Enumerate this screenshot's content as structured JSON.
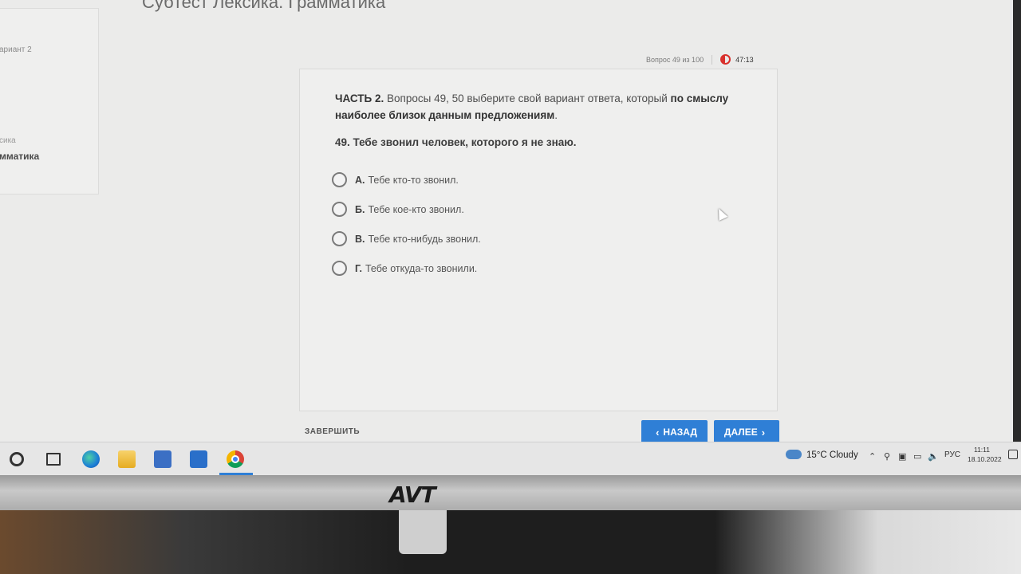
{
  "page": {
    "title": "Субтест Лексика. Грамматика"
  },
  "sidebar": {
    "variant": "ариант 2",
    "small_label": "сика",
    "bold_label": "мматика"
  },
  "meta": {
    "question_counter": "Вопрос 49 из 100",
    "timer": "47:13"
  },
  "card": {
    "instruction_prefix": "ЧАСТЬ 2.",
    "instruction_text": " Вопросы 49, 50 выберите свой вариант ответа, который ",
    "instruction_bold": "по смыслу наиболее близок данным предложениям",
    "instruction_end": ".",
    "question": "49. Тебе звонил человек, которого я не знаю.",
    "options": [
      {
        "letter": "А.",
        "text": "Тебе кто-то звонил."
      },
      {
        "letter": "Б.",
        "text": "Тебе кое-кто звонил."
      },
      {
        "letter": "В.",
        "text": "Тебе кто-нибудь звонил."
      },
      {
        "letter": "Г.",
        "text": "Тебе откуда-то звонили."
      }
    ]
  },
  "footer": {
    "finish_label": "ЗАВЕРШИТЬ",
    "back_label": "НАЗАД",
    "next_label": "ДАЛЕЕ",
    "button_color": "#2f7fd6"
  },
  "taskbar": {
    "icons": [
      "search-icon",
      "task-view-icon",
      "edge-icon",
      "file-explorer-icon",
      "store-icon",
      "mail-icon",
      "chrome-icon"
    ],
    "weather": "15°C  Cloudy",
    "language": "РУС",
    "time": "11:11",
    "date": "18.10.2022"
  },
  "monitor": {
    "brand": "AVT"
  }
}
